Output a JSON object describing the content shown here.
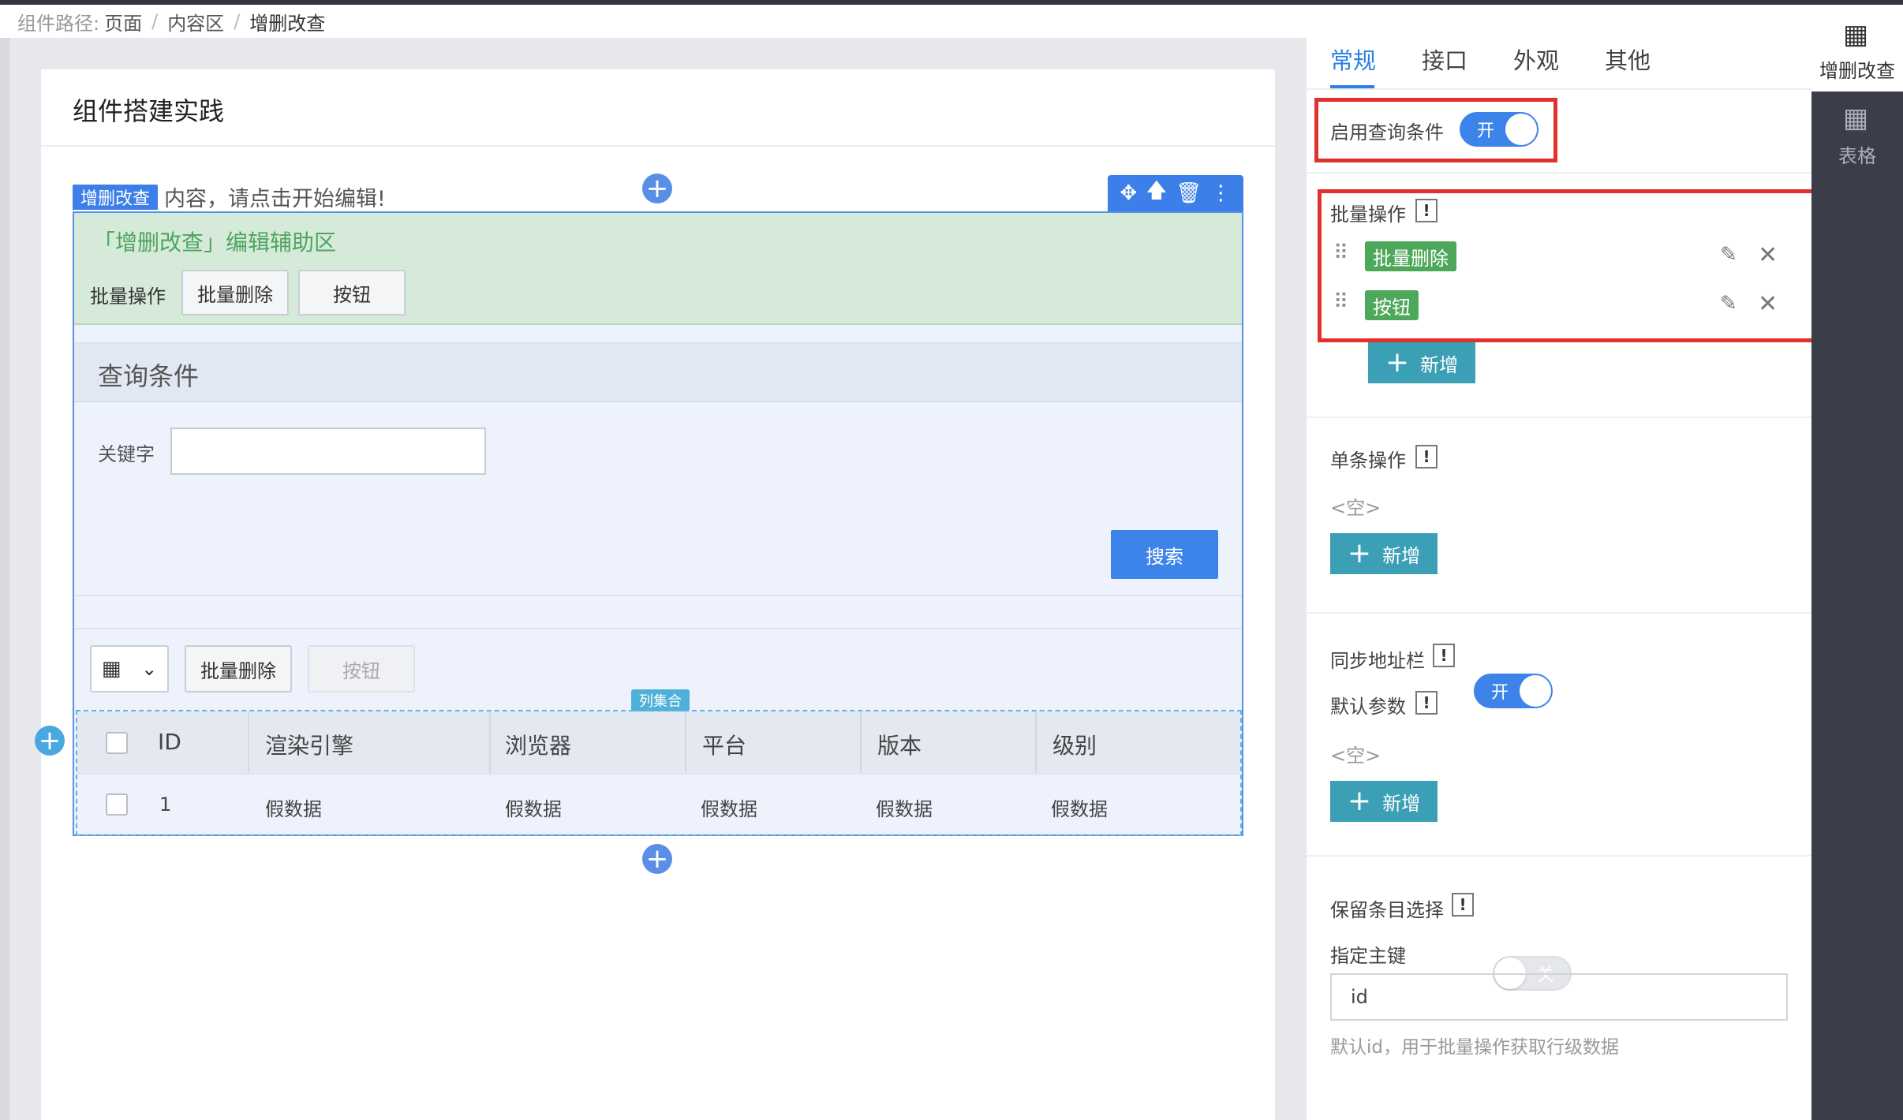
{
  "breadcrumb": {
    "label": "组件路径:",
    "items": [
      "页面",
      "内容区",
      "增删改查"
    ],
    "sep": "/"
  },
  "card": {
    "title": "组件搭建实践",
    "hint": "内容，请点击开始编辑!"
  },
  "component": {
    "tag": "增删改查",
    "col_tag": "列集合"
  },
  "assist": {
    "title": "「增删改查」编辑辅助区",
    "bulk_label": "批量操作",
    "buttons": [
      "批量删除",
      "按钮"
    ]
  },
  "query": {
    "title": "查询条件",
    "keyword_label": "关键字",
    "keyword_value": "",
    "search": "搜索"
  },
  "table_toolbar": {
    "buttons": [
      "批量删除",
      "按钮"
    ]
  },
  "table": {
    "headers": [
      "ID",
      "渲染引擎",
      "浏览器",
      "平台",
      "版本",
      "级别"
    ],
    "rows": [
      [
        "1",
        "假数据",
        "假数据",
        "假数据",
        "假数据",
        "假数据"
      ]
    ]
  },
  "panel": {
    "tabs": [
      "常规",
      "接口",
      "外观",
      "其他"
    ],
    "active_tab": "常规",
    "enable_query": {
      "label": "启用查询条件",
      "state": "开",
      "on": true
    },
    "bulk": {
      "label": "批量操作",
      "items": [
        "批量删除",
        "按钮"
      ],
      "add": "新增"
    },
    "single": {
      "label": "单条操作",
      "empty": "<空>",
      "add": "新增"
    },
    "sync": {
      "label": "同步地址栏",
      "state": "开",
      "on": true
    },
    "default_params": {
      "label": "默认参数",
      "empty": "<空>",
      "add": "新增"
    },
    "keep": {
      "label": "保留条目选择",
      "state": "关",
      "on": false
    },
    "pk": {
      "label": "指定主键",
      "value": "id",
      "hint": "默认id，用于批量操作获取行级数据"
    }
  },
  "sidebar": {
    "items": [
      "增删改查",
      "表格"
    ],
    "active": "增删改查"
  },
  "colors": {
    "accent": "#3d84ea",
    "green_tag": "#4da85a",
    "highlight": "#e0312e",
    "add_button": "#3b9fb6"
  }
}
